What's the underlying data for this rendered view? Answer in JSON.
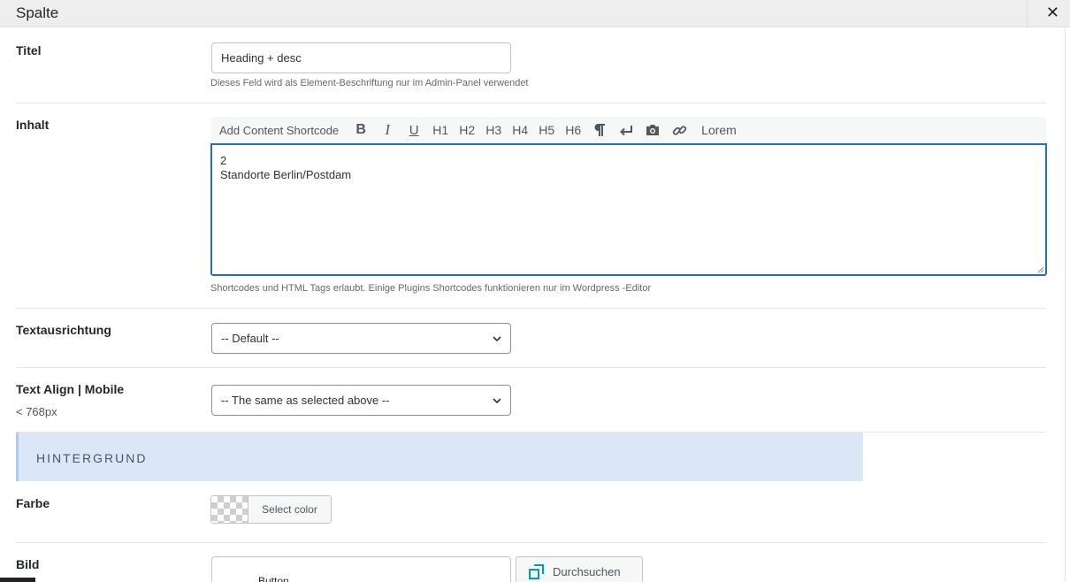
{
  "modal": {
    "title": "Spalte",
    "close_glyph": "✕"
  },
  "fields": {
    "title": {
      "label": "Titel",
      "value": "Heading + desc",
      "hint": "Dieses Feld wird als Element-Beschriftung nur im Admin-Panel verwendet"
    },
    "content": {
      "label": "Inhalt",
      "toolbar": {
        "add_shortcode": "Add Content Shortcode",
        "bold": "B",
        "italic": "I",
        "underline": "U",
        "h1": "H1",
        "h2": "H2",
        "h3": "H3",
        "h4": "H4",
        "h5": "H5",
        "h6": "H6",
        "lorem": "Lorem",
        "icons": [
          "paragraph-icon",
          "line-break-icon",
          "camera-icon",
          "link-icon"
        ]
      },
      "lines": [
        "2",
        "Standorte Berlin/Postdam"
      ],
      "hint": "Shortcodes und HTML Tags erlaubt. Einige Plugins Shortcodes funktionieren nur im Wordpress -Editor"
    },
    "text_align": {
      "label": "Textausrichtung",
      "selected": "-- Default --"
    },
    "text_align_mobile": {
      "label": "Text Align | Mobile",
      "sublabel": "< 768px",
      "selected": "-- The same as selected above --"
    }
  },
  "background_section": {
    "title": "HINTERGRUND",
    "color": {
      "label": "Farbe",
      "button_label": "Select color"
    },
    "image": {
      "label": "Bild",
      "browse_label": "Durchsuchen"
    }
  },
  "underlay": {
    "partial_text": "Button"
  },
  "colors": {
    "accent_focus": "#2271b1",
    "section_bg": "#dbe6f7",
    "browse_icon": "#00a0a0"
  }
}
